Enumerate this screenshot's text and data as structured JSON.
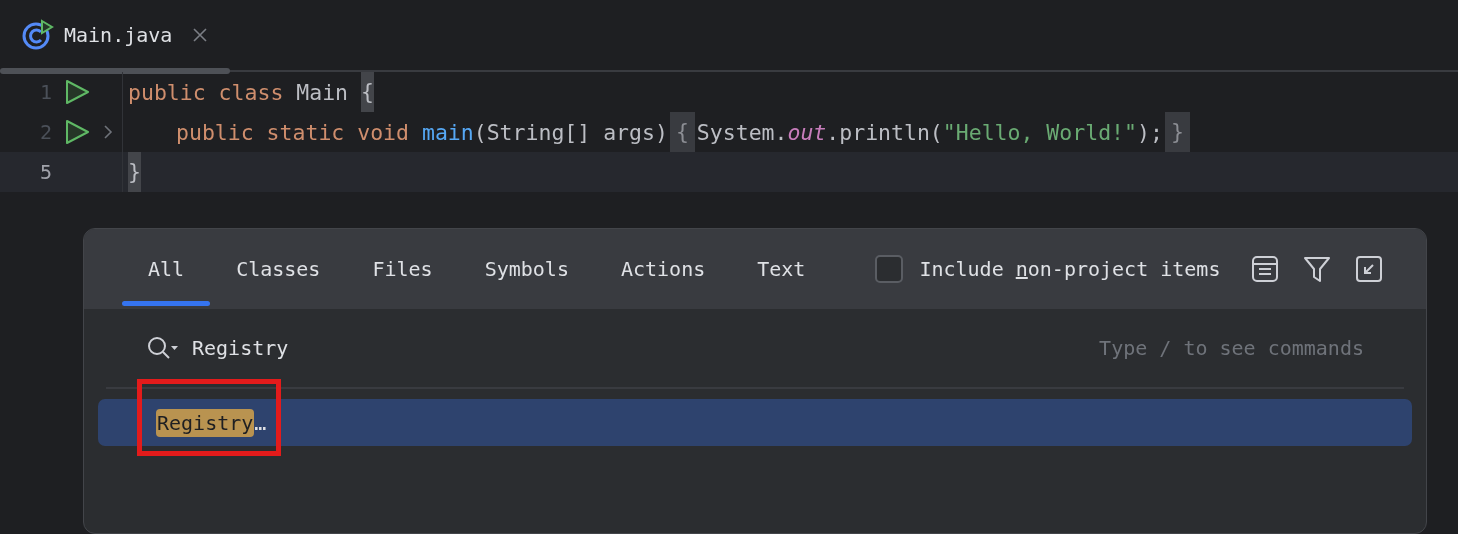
{
  "editor_tabs": [
    {
      "label": "Main.java",
      "selected": true,
      "closable": true
    }
  ],
  "code_lines": [
    {
      "number": "1",
      "run": true,
      "folded": false,
      "current": false,
      "tokens": [
        {
          "text": "public class ",
          "kind": "keyword"
        },
        {
          "text": "Main ",
          "kind": "plain"
        },
        {
          "text": "{",
          "kind": "brace_match"
        }
      ]
    },
    {
      "number": "2",
      "run": true,
      "folded": true,
      "current": false,
      "indented": true,
      "tokens": [
        {
          "text": "public static void ",
          "kind": "keyword"
        },
        {
          "text": "main",
          "kind": "method"
        },
        {
          "text": "(String[] args)",
          "kind": "plain"
        },
        {
          "text": "{",
          "kind": "fold"
        },
        {
          "text": "System.",
          "kind": "plain"
        },
        {
          "text": "out",
          "kind": "static_field"
        },
        {
          "text": ".println(",
          "kind": "plain"
        },
        {
          "text": "\"Hello, World!\"",
          "kind": "string"
        },
        {
          "text": ");",
          "kind": "plain"
        },
        {
          "text": "}",
          "kind": "fold"
        }
      ]
    },
    {
      "number": "5",
      "run": false,
      "folded": false,
      "current": true,
      "tokens": [
        {
          "text": "}",
          "kind": "brace_match"
        }
      ]
    }
  ],
  "search_popup": {
    "tabs": [
      {
        "label": "All",
        "selected": true
      },
      {
        "label": "Classes",
        "selected": false
      },
      {
        "label": "Files",
        "selected": false
      },
      {
        "label": "Symbols",
        "selected": false
      },
      {
        "label": "Actions",
        "selected": false
      },
      {
        "label": "Text",
        "selected": false
      }
    ],
    "include_non_project": {
      "label_parts": [
        "Include ",
        "n",
        "on-project items"
      ],
      "checked": false
    },
    "toolbar": [
      {
        "kind": "preview"
      },
      {
        "kind": "filter"
      },
      {
        "kind": "collapse"
      }
    ],
    "search": {
      "value": "Registry",
      "placeholder": "Type / to see commands"
    },
    "results": [
      {
        "match": "Registry",
        "rest": "…",
        "selected": true,
        "annotated": true
      }
    ]
  }
}
